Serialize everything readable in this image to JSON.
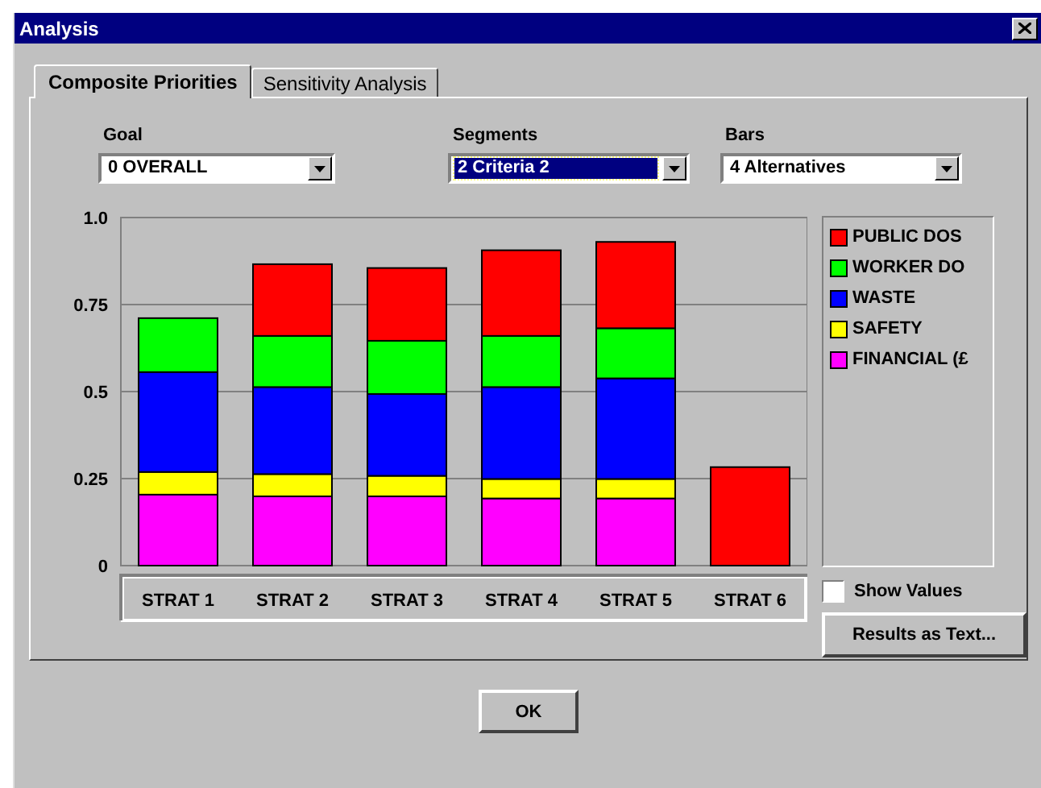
{
  "window": {
    "title": "Analysis"
  },
  "tabs": [
    {
      "label": "Composite Priorities",
      "selected": true
    },
    {
      "label": "Sensitivity Analysis",
      "selected": false
    }
  ],
  "dropdowns": [
    {
      "label": "Goal",
      "value": "0 OVERALL",
      "focused": false
    },
    {
      "label": "Segments",
      "value": "2 Criteria 2",
      "focused": true
    },
    {
      "label": "Bars",
      "value": "4 Alternatives",
      "focused": false
    }
  ],
  "chart": {
    "chart_data": {
      "type": "bar",
      "stacked": true,
      "grid": true,
      "categories": [
        "STRAT 1",
        "STRAT 2",
        "STRAT 3",
        "STRAT 4",
        "STRAT 5",
        "STRAT 6"
      ],
      "ylim": [
        0,
        1
      ],
      "yticks": [
        0,
        0.25,
        0.5,
        0.75,
        {
          "value": 1,
          "label": "1.0"
        }
      ],
      "series": [
        {
          "name": "PUBLIC DOS",
          "color": "#ff0000",
          "values": [
            0,
            0.206,
            0.209,
            0.246,
            0.248,
            0.283
          ]
        },
        {
          "name": "WORKER DO",
          "color": "#00ff00",
          "values": [
            0.155,
            0.147,
            0.153,
            0.147,
            0.144,
            0
          ]
        },
        {
          "name": "WASTE",
          "color": "#0000ff",
          "values": [
            0.287,
            0.25,
            0.235,
            0.264,
            0.289,
            0
          ]
        },
        {
          "name": "SAFETY",
          "color": "#ffff00",
          "values": [
            0.065,
            0.064,
            0.059,
            0.056,
            0.056,
            0
          ]
        },
        {
          "name": "FINANCIAL (£",
          "color": "#ff00ff",
          "values": [
            0.204,
            0.199,
            0.199,
            0.193,
            0.193,
            0
          ]
        }
      ]
    }
  },
  "show_values": {
    "label": "Show Values",
    "checked": false
  },
  "buttons": {
    "results": "Results as Text...",
    "ok": "OK"
  }
}
